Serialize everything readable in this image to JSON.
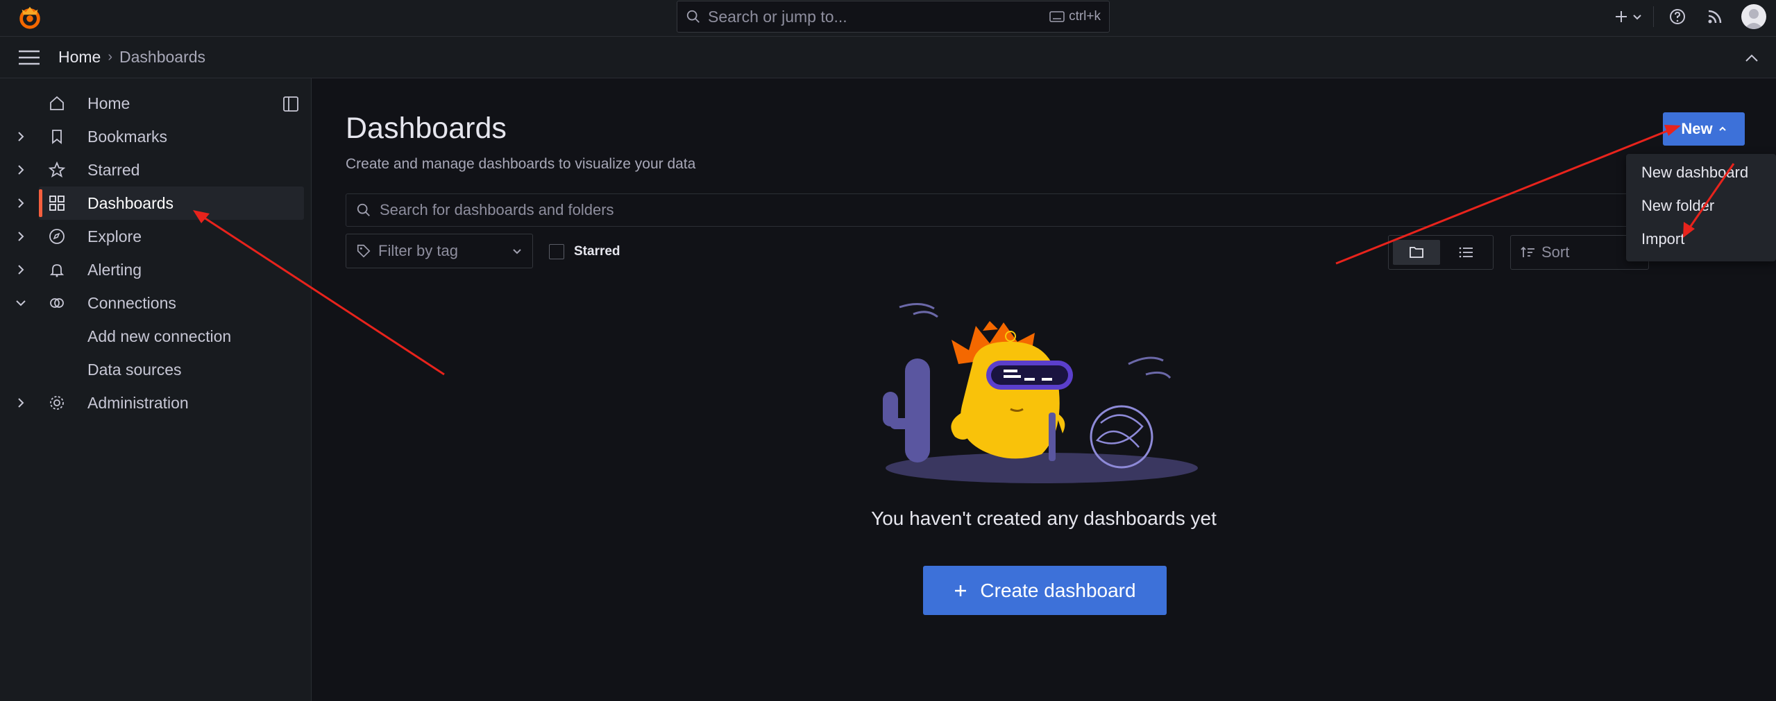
{
  "topbar": {
    "search_placeholder": "Search or jump to...",
    "search_shortcut": "ctrl+k"
  },
  "breadcrumb": {
    "home": "Home",
    "separator": "›",
    "current": "Dashboards"
  },
  "sidebar": {
    "items": [
      {
        "label": "Home",
        "icon": "home-icon"
      },
      {
        "label": "Bookmarks",
        "icon": "bookmark-icon"
      },
      {
        "label": "Starred",
        "icon": "star-icon"
      },
      {
        "label": "Dashboards",
        "icon": "apps-icon",
        "active": true
      },
      {
        "label": "Explore",
        "icon": "compass-icon"
      },
      {
        "label": "Alerting",
        "icon": "bell-icon"
      },
      {
        "label": "Connections",
        "icon": "link-icon"
      },
      {
        "label": "Add new connection"
      },
      {
        "label": "Data sources"
      },
      {
        "label": "Administration",
        "icon": "cog-icon"
      }
    ]
  },
  "main": {
    "title": "Dashboards",
    "subtitle": "Create and manage dashboards to visualize your data",
    "new_button": "New",
    "search_placeholder": "Search for dashboards and folders",
    "filter_tag": "Filter by tag",
    "starred_label": "Starred",
    "sort_label": "Sort",
    "empty_message": "You haven't created any dashboards yet",
    "create_button": "Create dashboard"
  },
  "new_menu": {
    "items": [
      "New dashboard",
      "New folder",
      "Import"
    ]
  },
  "colors": {
    "accent": "#3d71d9",
    "active_bar": "#f55f3e",
    "annotation_arrow": "#e8231c"
  }
}
